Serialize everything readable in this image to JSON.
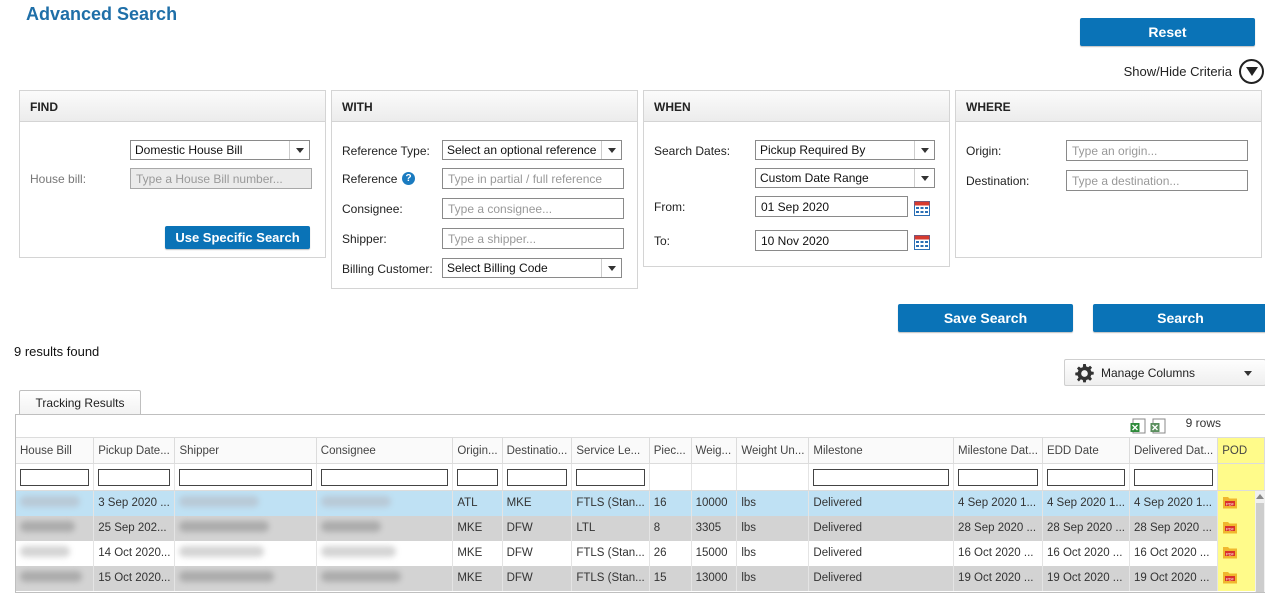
{
  "page": {
    "title": "Advanced Search",
    "reset_label": "Reset",
    "show_hide_label": "Show/Hide Criteria"
  },
  "find": {
    "header": "FIND",
    "type_value": "Domestic House Bill",
    "house_bill_label": "House bill:",
    "house_bill_placeholder": "Type a House Bill number...",
    "use_specific_label": "Use Specific Search"
  },
  "with": {
    "header": "WITH",
    "reference_type_label": "Reference Type:",
    "reference_type_value": "Select an optional reference",
    "reference_label": "Reference",
    "reference_placeholder": "Type in partial / full reference",
    "consignee_label": "Consignee:",
    "consignee_placeholder": "Type a consignee...",
    "shipper_label": "Shipper:",
    "shipper_placeholder": "Type a shipper...",
    "billing_label": "Billing Customer:",
    "billing_value": "Select Billing Code"
  },
  "when": {
    "header": "WHEN",
    "search_dates_label": "Search Dates:",
    "search_dates_value": "Pickup Required By",
    "range_value": "Custom Date Range",
    "from_label": "From:",
    "from_value": "01 Sep 2020",
    "to_label": "To:",
    "to_value": "10 Nov 2020"
  },
  "where": {
    "header": "WHERE",
    "origin_label": "Origin:",
    "origin_placeholder": "Type an origin...",
    "destination_label": "Destination:",
    "destination_placeholder": "Type a destination..."
  },
  "actions": {
    "save_search_label": "Save Search",
    "search_label": "Search"
  },
  "results": {
    "count_text": "9 results found",
    "manage_columns_label": "Manage Columns",
    "tab_label": "Tracking Results",
    "rows_text": "9 rows",
    "columns": [
      "House Bill",
      "Pickup Date...",
      "Shipper",
      "Consignee",
      "Origin...",
      "Destinatio...",
      "Service Le...",
      "Piec...",
      "Weig...",
      "Weight Un...",
      "Milestone",
      "Milestone Dat...",
      "EDD Date",
      "Delivered Dat...",
      "POD"
    ],
    "rows": [
      {
        "pickup": "3 Sep 2020 ...",
        "origin": "ATL",
        "dest": "MKE",
        "service": "FTLS (Stan...",
        "pieces": "16",
        "weight": "10000",
        "unit": "lbs",
        "milestone": "Delivered",
        "milestone_date": "4 Sep 2020 1...",
        "edd": "4 Sep 2020 1...",
        "delivered": "4 Sep 2020 1..."
      },
      {
        "pickup": "25 Sep 202...",
        "origin": "MKE",
        "dest": "DFW",
        "service": "LTL",
        "pieces": "8",
        "weight": "3305",
        "unit": "lbs",
        "milestone": "Delivered",
        "milestone_date": "28 Sep 2020 ...",
        "edd": "28 Sep 2020 ...",
        "delivered": "28 Sep 2020 ..."
      },
      {
        "pickup": "14 Oct 2020...",
        "origin": "MKE",
        "dest": "DFW",
        "service": "FTLS (Stan...",
        "pieces": "26",
        "weight": "15000",
        "unit": "lbs",
        "milestone": "Delivered",
        "milestone_date": "16 Oct 2020 ...",
        "edd": "16 Oct 2020 ...",
        "delivered": "16 Oct 2020 ..."
      },
      {
        "pickup": "15 Oct 2020...",
        "origin": "MKE",
        "dest": "DFW",
        "service": "FTLS (Stan...",
        "pieces": "15",
        "weight": "13000",
        "unit": "lbs",
        "milestone": "Delivered",
        "milestone_date": "19 Oct 2020 ...",
        "edd": "19 Oct 2020 ...",
        "delivered": "19 Oct 2020 ..."
      }
    ]
  },
  "colors": {
    "accent": "#0a73b7",
    "title": "#1f6fa8",
    "selected_row": "#bfe1f4",
    "pod_highlight": "#fffb8a"
  },
  "icons": {
    "show_hide": "chevron-down-circle-icon",
    "help": "help-icon",
    "calendar": "calendar-icon",
    "gear": "gear-icon",
    "export_excel": "excel-export-icon",
    "pdf": "pdf-icon"
  }
}
